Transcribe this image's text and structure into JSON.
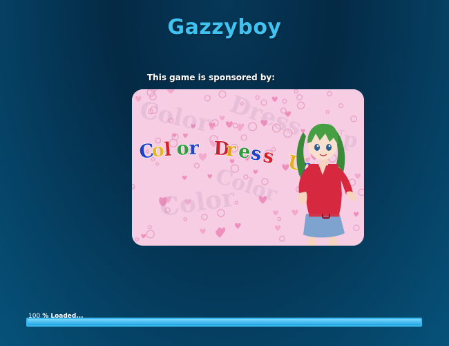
{
  "header": {
    "title": "Gazzyboy"
  },
  "sponsor": {
    "caption": "This game is  sponsored by:",
    "logo_text": "Color Dress Up",
    "logo_letter_colors": [
      "#1f3fc8",
      "#e8b62a",
      "#d7262b",
      "#2f9f3a",
      "#2343c9",
      "#c51f33",
      "#e1a11d",
      "#2c9b3c",
      "#1e44c4",
      "#d31f2d",
      "#e6b026",
      "#2a49c7"
    ],
    "banner_bg": "#f7cde3"
  },
  "loader": {
    "percent": "100",
    "label": "% Loaded...",
    "progress": 1.0
  },
  "colors": {
    "title": "#3fc2f0",
    "progress_border": "#3ab8ec",
    "progress_fill": "#4cc3f5"
  }
}
